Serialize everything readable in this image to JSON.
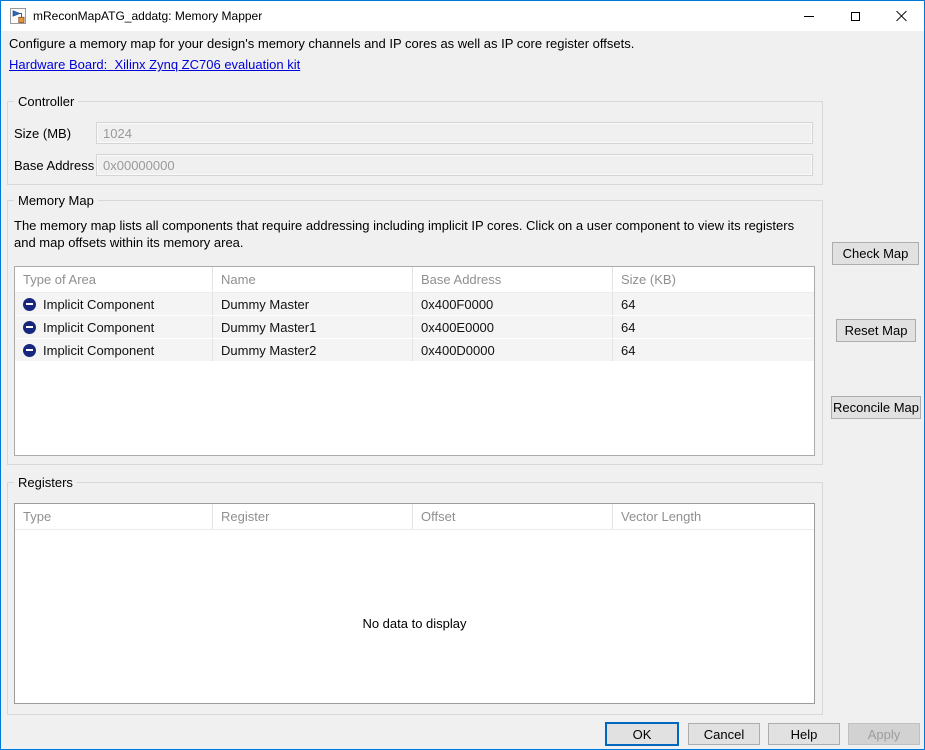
{
  "window": {
    "title": "mReconMapATG_addatg: Memory Mapper"
  },
  "intro": {
    "description": "Configure a memory map for your design's memory channels and IP cores as well as IP core register offsets.",
    "hardware_board_link": "Hardware Board:  Xilinx Zynq ZC706 evaluation kit"
  },
  "controller": {
    "title": "Controller",
    "size_label": "Size (MB)",
    "size_value": "1024",
    "base_label": "Base Address",
    "base_value": "0x00000000"
  },
  "memory_map": {
    "title": "Memory Map",
    "description": "The memory map lists all components that require addressing including implicit IP cores. Click on a user component to view its registers and map offsets within its memory area.",
    "columns": [
      "Type of Area",
      "Name",
      "Base Address",
      "Size (KB)"
    ],
    "rows": [
      {
        "type": "Implicit Component",
        "name": "Dummy Master",
        "base_address": "0x400F0000",
        "size_kb": "64"
      },
      {
        "type": "Implicit Component",
        "name": "Dummy Master1",
        "base_address": "0x400E0000",
        "size_kb": "64"
      },
      {
        "type": "Implicit Component",
        "name": "Dummy Master2",
        "base_address": "0x400D0000",
        "size_kb": "64"
      }
    ]
  },
  "side_buttons": {
    "check": "Check Map",
    "reset": "Reset Map",
    "reconcile": "Reconcile Map"
  },
  "registers": {
    "title": "Registers",
    "columns": [
      "Type",
      "Register",
      "Offset",
      "Vector Length"
    ],
    "empty_message": "No data to display"
  },
  "footer": {
    "ok": "OK",
    "cancel": "Cancel",
    "help": "Help",
    "apply": "Apply"
  },
  "icons": {
    "titlebar": "simulink-model-icon",
    "window_controls": [
      "minimize-icon",
      "maximize-icon",
      "close-icon"
    ],
    "row_icon": "minus-circle-icon"
  },
  "colors": {
    "accent": "#0078d7",
    "link": "#0000d8",
    "titlebar_bg": "#ffffff",
    "body_bg": "#f0f0f0",
    "button_bg": "#e1e1e1",
    "button_border": "#adadad",
    "disabled_text": "#9d9d9d",
    "table_header_text": "#8f8f8f",
    "row_icon_color": "#17277e"
  }
}
